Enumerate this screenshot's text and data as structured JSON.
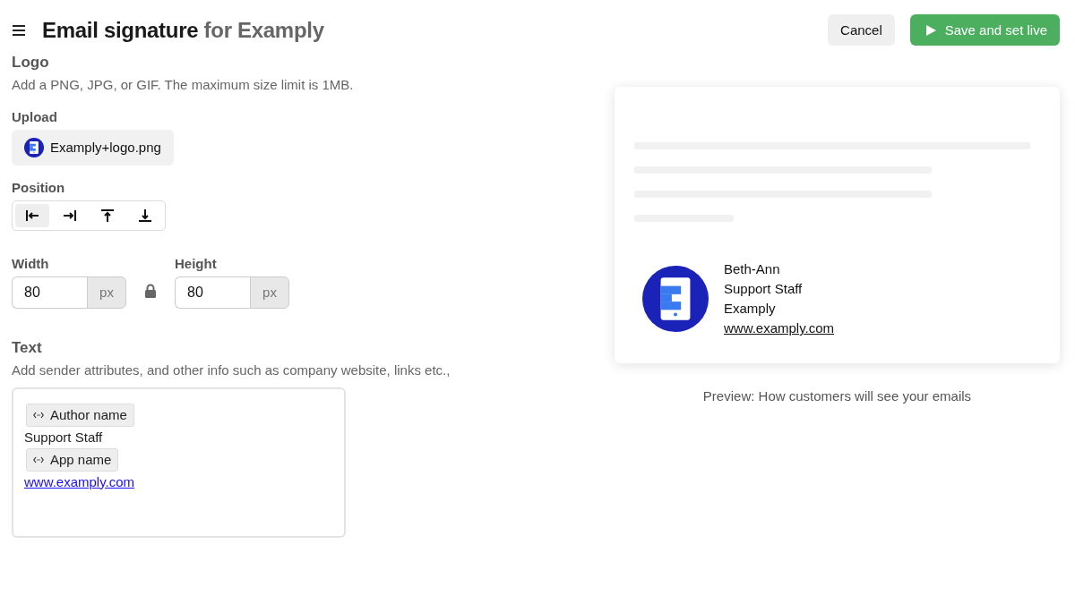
{
  "header": {
    "title": "Email signature",
    "subtitle": "for Examply",
    "buttons": [
      {
        "kind": "secondary",
        "label": "Cancel"
      },
      {
        "kind": "primary",
        "label": "Save and set live"
      }
    ]
  },
  "logo": {
    "heading": "Logo",
    "hint": "Add a PNG, JPG, or GIF. The maximum size limit is 1MB.",
    "upload_label": "Upload",
    "file_name": "Examply+logo.png",
    "position_label": "Position",
    "positions": [
      {
        "kind": "left",
        "selected": true
      },
      {
        "kind": "right",
        "selected": false
      },
      {
        "kind": "top",
        "selected": false
      },
      {
        "kind": "bottom",
        "selected": false
      }
    ],
    "width": {
      "label": "Width",
      "value": "80",
      "unit": "px"
    },
    "height": {
      "label": "Height",
      "value": "80",
      "unit": "px"
    }
  },
  "text": {
    "heading": "Text",
    "hint": "Add sender attributes, and other info such as company website, links etc.,",
    "lines": [
      {
        "kind": "token",
        "text": "Author name"
      },
      {
        "kind": "text",
        "text": "Support Staff"
      },
      {
        "kind": "token",
        "text": "App name"
      },
      {
        "kind": "link",
        "text": "www.examply.com"
      }
    ]
  },
  "preview": {
    "lines": [
      {
        "kind": "text",
        "text": "Beth-Ann"
      },
      {
        "kind": "text",
        "text": "Support Staff"
      },
      {
        "kind": "text",
        "text": "Examply"
      },
      {
        "kind": "link",
        "text": "www.examply.com"
      }
    ],
    "caption": "Preview: How customers will see your emails"
  }
}
